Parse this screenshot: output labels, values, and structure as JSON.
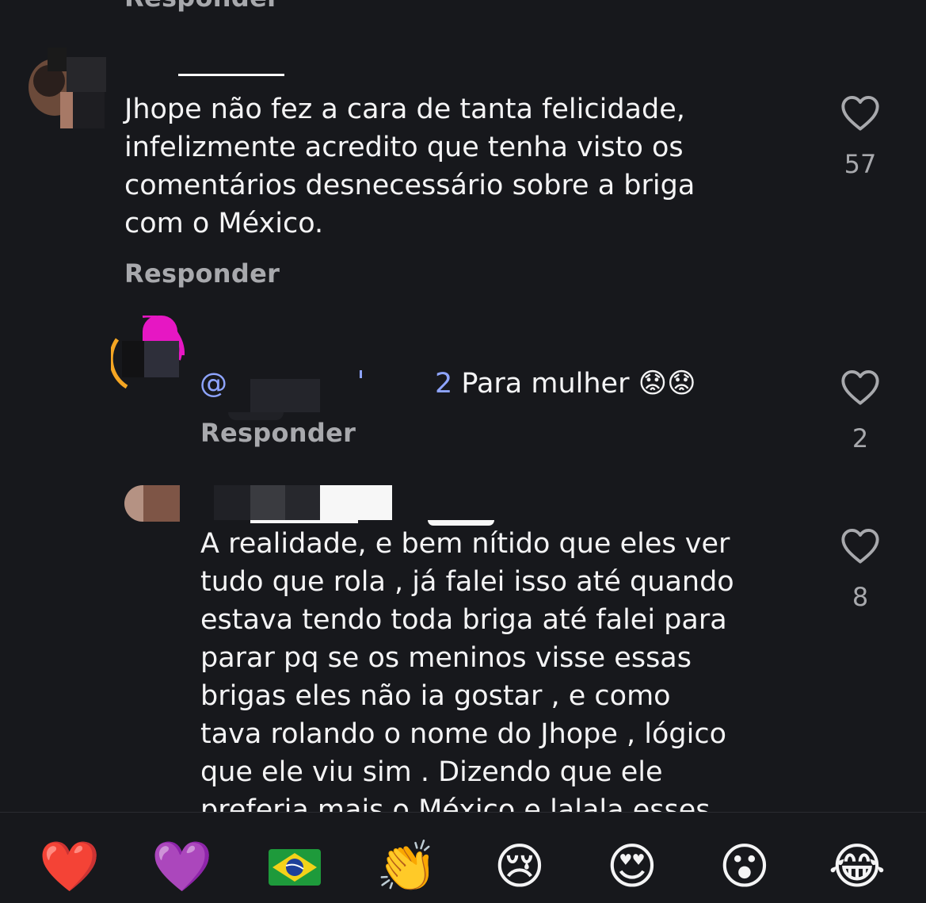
{
  "comments": [
    {
      "reply_label": "Responder"
    },
    {
      "text_lines": [
        "Jhope não fez a cara de tanta felicidade,",
        "infelizmente acredito que tenha visto os",
        "comentários desnecessário sobre a briga",
        "com o México."
      ],
      "reply_label": "Responder",
      "likes": "57"
    },
    {
      "mention": "@",
      "mention_suffix": "2",
      "text": "Para mulher",
      "emoji": "😟😟",
      "reply_label": "Responder",
      "likes": "2"
    },
    {
      "text_lines": [
        "A realidade, e bem nítido que eles ver",
        "tudo que rola , já falei isso até quando",
        "estava tendo toda briga até falei para",
        "parar pq se os meninos visse essas",
        "brigas eles não ia gostar , e como",
        "tava rolando o nome do Jhope , lógico",
        "que ele viu sim . Dizendo que ele",
        "preferia mais o México e lalala esses"
      ],
      "likes": "8"
    }
  ],
  "reaction_bar": [
    {
      "name": "red-heart",
      "glyph": "❤️"
    },
    {
      "name": "purple-heart",
      "glyph": "💜"
    },
    {
      "name": "brazil-flag",
      "glyph": "🇧🇷"
    },
    {
      "name": "clapping-hands",
      "glyph": "👏"
    },
    {
      "name": "crying-face",
      "glyph": "😢"
    },
    {
      "name": "heart-eyes",
      "glyph": "😍"
    },
    {
      "name": "surprised-face",
      "glyph": "😮"
    },
    {
      "name": "tears-of-joy",
      "glyph": "😂"
    }
  ],
  "colors": {
    "background": "#17181c",
    "text": "#f4f4f5",
    "muted": "#a8a9ad",
    "mention": "#8ea4ff",
    "story_ring_pink": "#e617c3",
    "story_ring_orange": "#f5a623"
  }
}
